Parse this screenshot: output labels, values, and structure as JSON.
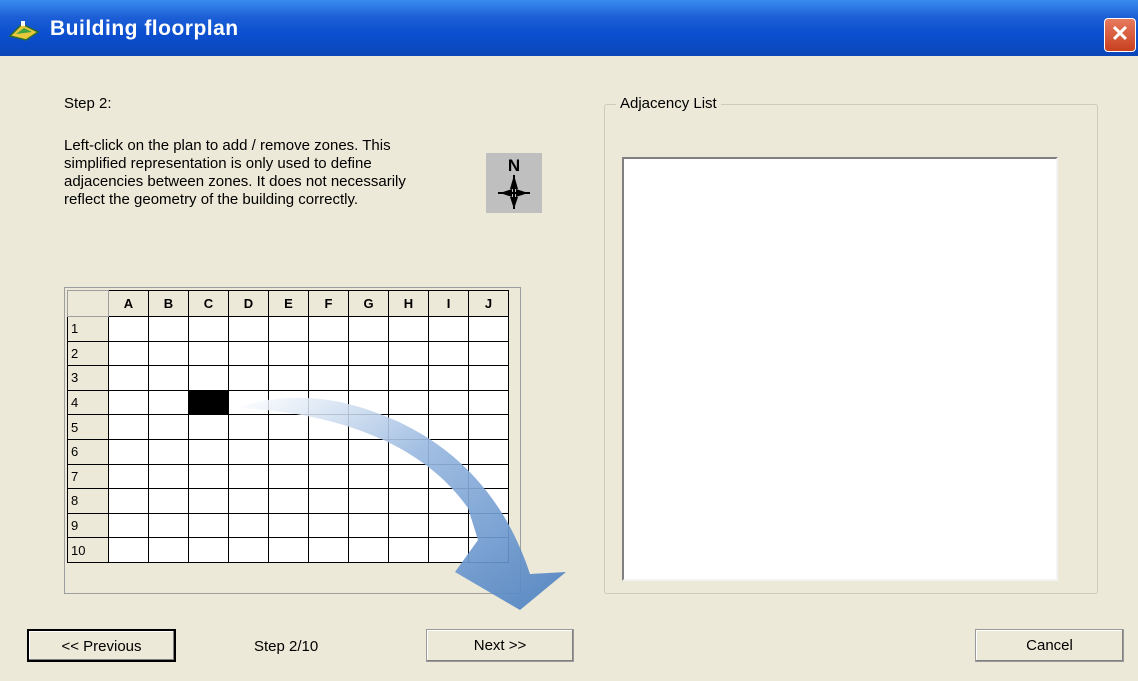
{
  "window": {
    "title": "Building floorplan",
    "close_glyph": "✕",
    "title_icon": "building-icon"
  },
  "step_label": "Step 2:",
  "instructions": "Left-click on the plan to add / remove zones. This simplified representation is only used to define adjacencies between zones. It does not necessarily reflect the geometry of the building correctly.",
  "compass": {
    "letter": "N",
    "icon": "north-compass-icon"
  },
  "grid": {
    "columns": [
      "A",
      "B",
      "C",
      "D",
      "E",
      "F",
      "G",
      "H",
      "I",
      "J"
    ],
    "rows": [
      "1",
      "2",
      "3",
      "4",
      "5",
      "6",
      "7",
      "8",
      "9",
      "10"
    ],
    "selected_cells": [
      "C4"
    ]
  },
  "adjacency": {
    "legend": "Adjacency List",
    "items": []
  },
  "footer": {
    "previous_label": "<< Previous",
    "step_count": "Step 2/10",
    "next_label": "Next >>",
    "cancel_label": "Cancel"
  },
  "colors": {
    "title_bar": "#0b4fd0",
    "dialog_bg": "#ece9d8",
    "arrow": "#4f84c4",
    "selected_cell": "#000000"
  }
}
